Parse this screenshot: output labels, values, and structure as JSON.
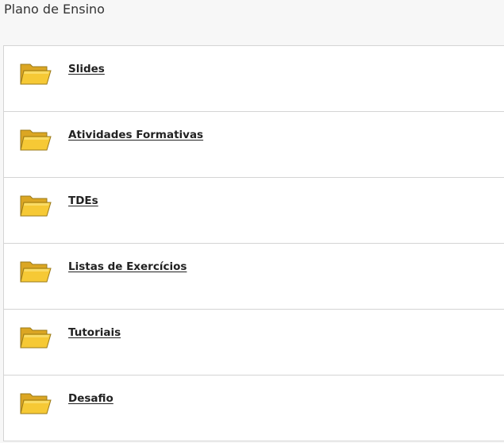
{
  "header": {
    "title": "Plano de Ensino"
  },
  "folders": [
    {
      "label": "Slides",
      "icon": "folder-icon"
    },
    {
      "label": "Atividades Formativas",
      "icon": "folder-icon"
    },
    {
      "label": "TDEs",
      "icon": "folder-icon"
    },
    {
      "label": "Listas de Exercícios",
      "icon": "folder-icon"
    },
    {
      "label": "Tutoriais",
      "icon": "folder-icon"
    },
    {
      "label": "Desafio",
      "icon": "folder-icon"
    }
  ],
  "colors": {
    "folder_fill": "#f6c935",
    "folder_back": "#e0a81c",
    "folder_stroke": "#9a7a1a",
    "divider": "#d4d4d4"
  }
}
